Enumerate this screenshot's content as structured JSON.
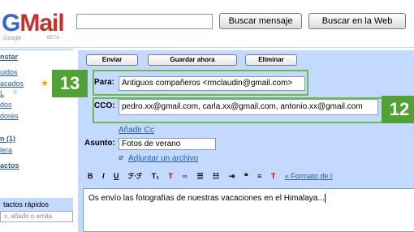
{
  "header": {
    "logo_text": "Mail",
    "logo_prefix": "G",
    "logo_sub": "Google",
    "logo_beta": "BETA",
    "search_mail_button": "Buscar mensaje",
    "search_web_button": "Buscar en la Web"
  },
  "nav": {
    "compose": "nstar",
    "items": [
      "uidos",
      "acados",
      "L",
      "dos",
      "dores",
      "",
      "n (1)",
      "lera",
      "actos"
    ],
    "quick_contacts_header": "tactos rápidos",
    "quick_contacts_placeholder": "x, añado o emita"
  },
  "toolbar": {
    "send": "Enviar",
    "save": "Guardar ahora",
    "discard": "Eliminar"
  },
  "form": {
    "to_label": "Para:",
    "to_value": "Antiguos compañeros <rmclaudin@gmail.com>",
    "bcc_label": "CCO:",
    "bcc_value": "pedro.xx@gmail.com, carla.xx@gmail.com, antonio.xx@gmail.com",
    "add_cc": "Añadir Cc",
    "subject_label": "Asunto:",
    "subject_value": "Fotos de verano",
    "attach_link": "Adjuntar un archivo",
    "format_link": "« Formato de t",
    "body_text": "Os envío las fotografías de nuestras vacaciones en el Himalaya..."
  },
  "callouts": {
    "to_number": "13",
    "bcc_number": "12",
    "color": "#4fa233"
  }
}
